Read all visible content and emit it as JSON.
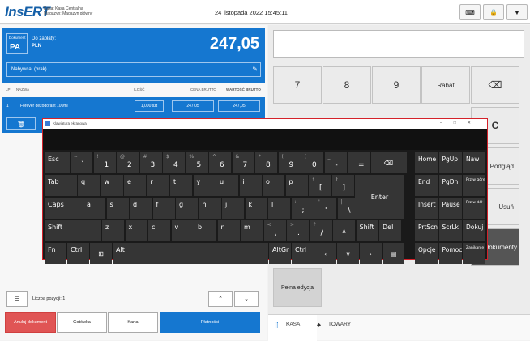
{
  "header": {
    "logo": "InsERT",
    "kasa_line1": "Kasa: Kasa Centralna",
    "kasa_line2": "Magazyn: Magazyn główny",
    "datetime": "24 listopada 2022 15:45:11"
  },
  "document": {
    "label": "Dokument",
    "type": "PA",
    "to_pay_label": "Do zapłaty:",
    "currency": "PLN",
    "amount": "247,05",
    "buyer": "Nabywca: (brak)"
  },
  "table": {
    "headers": [
      "LP",
      "NAZWA",
      "ILOŚĆ",
      "CENA BRUTTO",
      "WARTOŚĆ BRUTTO"
    ],
    "rows": [
      {
        "lp": "1",
        "name": "Forever dezodorant 100ml",
        "qty": "1,000 szt",
        "price": "247,05",
        "value": "247,05"
      }
    ]
  },
  "footer": {
    "count_label": "Liczba pozycji: 1",
    "cancel": "Anuluj dokument",
    "cash": "Gotówka",
    "card": "Karta",
    "payments": "Płatności"
  },
  "keypad": {
    "keys": [
      "7",
      "8",
      "9",
      "Rabat"
    ],
    "right_labels": [
      "C",
      "Podgląd",
      "Usuń",
      "Dokumenty"
    ],
    "full_edit": "Pełna edycja"
  },
  "tabs": {
    "kasa": "KASA",
    "towary": "TOWARY"
  },
  "osk": {
    "title": "Klawiatura ekranowa",
    "row1": [
      {
        "u": "~",
        "l": "`"
      },
      {
        "u": "!",
        "l": "1"
      },
      {
        "u": "@",
        "l": "2"
      },
      {
        "u": "#",
        "l": "3"
      },
      {
        "u": "$",
        "l": "4"
      },
      {
        "u": "%",
        "l": "5"
      },
      {
        "u": "^",
        "l": "6"
      },
      {
        "u": "&",
        "l": "7"
      },
      {
        "u": "*",
        "l": "8"
      },
      {
        "u": "(",
        "l": "9"
      },
      {
        "u": ")",
        "l": "0"
      },
      {
        "u": "_",
        "l": "-"
      },
      {
        "u": "+",
        "l": "="
      }
    ],
    "row2": [
      "q",
      "w",
      "e",
      "r",
      "t",
      "y",
      "u",
      "i",
      "o",
      "p"
    ],
    "row3": [
      "a",
      "s",
      "d",
      "f",
      "g",
      "h",
      "j",
      "k",
      "l"
    ],
    "row4": [
      "z",
      "x",
      "c",
      "v",
      "b",
      "n",
      "m"
    ],
    "labels": {
      "esc": "Esc",
      "tab": "Tab",
      "caps": "Caps",
      "shift": "Shift",
      "fn": "Fn",
      "ctrl": "Ctrl",
      "alt": "Alt",
      "altgr": "AltGr",
      "enter": "Enter",
      "del": "Del"
    },
    "nav": [
      [
        "Home",
        "PgUp",
        "Naw"
      ],
      [
        "End",
        "PgDn",
        "Prz w górę"
      ],
      [
        "Insert",
        "Pause",
        "Prz w dół"
      ],
      [
        "PrtScn",
        "ScrLk",
        "Dokuj"
      ],
      [
        "Opcje",
        "Pomoc",
        "Zanikanie"
      ]
    ]
  }
}
